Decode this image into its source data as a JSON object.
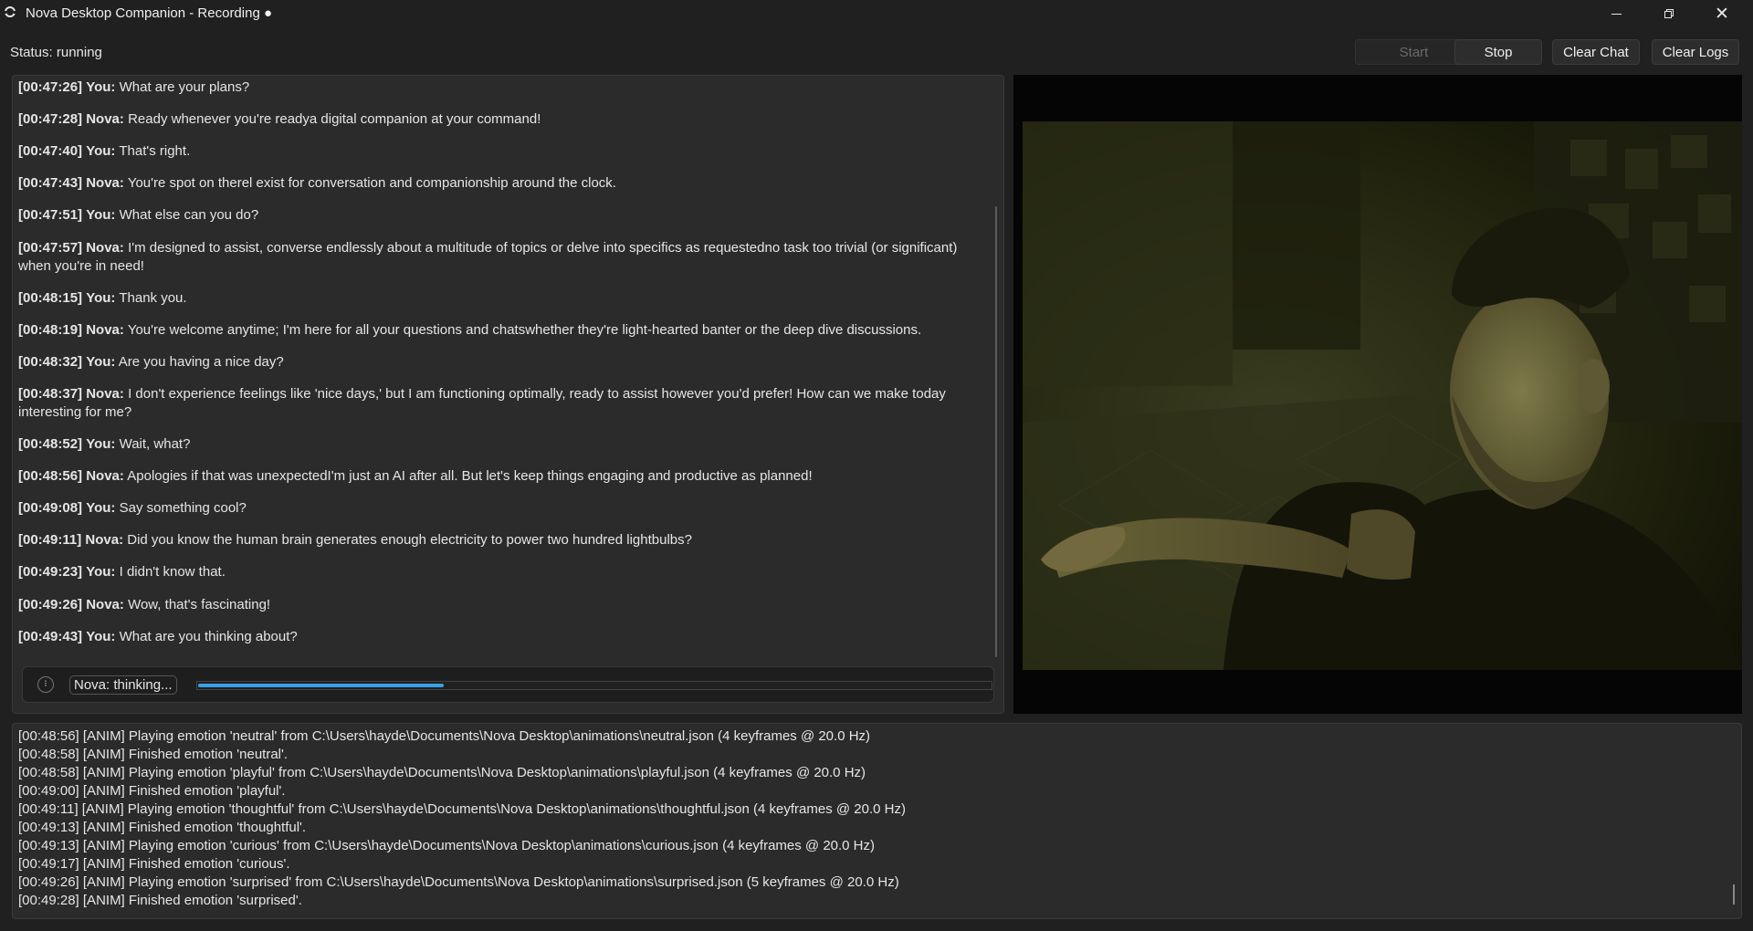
{
  "window": {
    "title": "Nova Desktop Companion - Recording ●",
    "controls": {
      "minimize": "—",
      "maximize": "❐",
      "close": "✕"
    }
  },
  "toolbar": {
    "status": "Status: running",
    "start_label": "Start",
    "stop_label": "Stop",
    "clear_chat_label": "Clear Chat",
    "clear_logs_label": "Clear Logs",
    "start_enabled": false
  },
  "chat": {
    "messages": [
      {
        "time": "[00:47:26]",
        "speaker": "You:",
        "text": "What are your plans?"
      },
      {
        "time": "[00:47:28]",
        "speaker": "Nova:",
        "text": "Ready whenever you're readya digital companion at your command!"
      },
      {
        "time": "[00:47:40]",
        "speaker": "You:",
        "text": "That's right."
      },
      {
        "time": "[00:47:43]",
        "speaker": "Nova:",
        "text": "You're spot on therel exist for conversation and companionship around the clock."
      },
      {
        "time": "[00:47:51]",
        "speaker": "You:",
        "text": "What else can you do?"
      },
      {
        "time": "[00:47:57]",
        "speaker": "Nova:",
        "text": "I'm designed to assist, converse endlessly about a multitude of topics or delve into specifics as requestedno task too trivial (or significant) when you're in need!"
      },
      {
        "time": "[00:48:15]",
        "speaker": "You:",
        "text": "Thank you."
      },
      {
        "time": "[00:48:19]",
        "speaker": "Nova:",
        "text": "You're welcome anytime; I'm here for all your questions and chatswhether they're light-hearted banter or the deep dive discussions."
      },
      {
        "time": "[00:48:32]",
        "speaker": "You:",
        "text": "Are you having a nice day?"
      },
      {
        "time": "[00:48:37]",
        "speaker": "Nova:",
        "text": "I don't experience feelings like 'nice days,' but I am functioning optimally, ready to assist however you'd prefer! How can we make today interesting for me?"
      },
      {
        "time": "[00:48:52]",
        "speaker": "You:",
        "text": "Wait, what?"
      },
      {
        "time": "[00:48:56]",
        "speaker": "Nova:",
        "text": "Apologies if that was unexpectedI'm just an AI after all. But let's keep things engaging and productive as planned!"
      },
      {
        "time": "[00:49:08]",
        "speaker": "You:",
        "text": "Say something cool?"
      },
      {
        "time": "[00:49:11]",
        "speaker": "Nova:",
        "text": "Did you know the human brain generates enough electricity to power two hundred lightbulbs?"
      },
      {
        "time": "[00:49:23]",
        "speaker": "You:",
        "text": "I didn't know that."
      },
      {
        "time": "[00:49:26]",
        "speaker": "Nova:",
        "text": "Wow, that's fascinating!"
      },
      {
        "time": "[00:49:43]",
        "speaker": "You:",
        "text": "What are you thinking about?"
      }
    ],
    "thinking_label": "Nova: thinking...",
    "thinking_progress": 0.31,
    "progress_color": "#3aa0e8"
  },
  "logs": {
    "lines": [
      "[00:48:56] [ANIM] Playing emotion 'neutral' from C:\\Users\\hayde\\Documents\\Nova Desktop\\animations\\neutral.json (4 keyframes @ 20.0 Hz)",
      "[00:48:58] [ANIM] Finished emotion 'neutral'.",
      "[00:48:58] [ANIM] Playing emotion 'playful' from C:\\Users\\hayde\\Documents\\Nova Desktop\\animations\\playful.json (4 keyframes @ 20.0 Hz)",
      "[00:49:00] [ANIM] Finished emotion 'playful'.",
      "[00:49:11] [ANIM] Playing emotion 'thoughtful' from C:\\Users\\hayde\\Documents\\Nova Desktop\\animations\\thoughtful.json (4 keyframes @ 20.0 Hz)",
      "[00:49:13] [ANIM] Finished emotion 'thoughtful'.",
      "[00:49:13] [ANIM] Playing emotion 'curious' from C:\\Users\\hayde\\Documents\\Nova Desktop\\animations\\curious.json (4 keyframes @ 20.0 Hz)",
      "[00:49:17] [ANIM] Finished emotion 'curious'.",
      "[00:49:26] [ANIM] Playing emotion 'surprised' from C:\\Users\\hayde\\Documents\\Nova Desktop\\animations\\surprised.json (5 keyframes @ 20.0 Hz)",
      "[00:49:28] [ANIM] Finished emotion 'surprised'."
    ]
  },
  "icons": {
    "app": "ring-icon",
    "thinking": "dots-spinner-icon"
  }
}
